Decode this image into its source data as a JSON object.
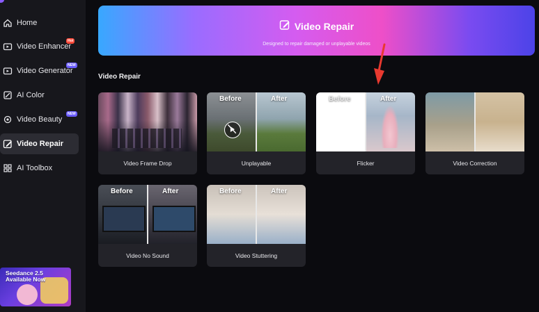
{
  "sidebar": {
    "items": [
      {
        "label": "Home",
        "icon": "home-icon"
      },
      {
        "label": "Video Enhancer",
        "icon": "video-enhancer-icon",
        "badge": "Hot"
      },
      {
        "label": "Video Generator",
        "icon": "video-generator-icon",
        "badge": "NEW"
      },
      {
        "label": "AI Color",
        "icon": "ai-color-icon"
      },
      {
        "label": "Video Beauty",
        "icon": "video-beauty-icon",
        "badge": "NEW"
      },
      {
        "label": "Video Repair",
        "icon": "video-repair-icon",
        "active": true
      },
      {
        "label": "AI Toolbox",
        "icon": "ai-toolbox-icon"
      }
    ],
    "promo": {
      "line1": "Seedance 2.5",
      "line2": "Available Now"
    }
  },
  "banner": {
    "title": "Video Repair",
    "subtitle": "Designed to repair damaged or unplayable videos",
    "icon": "edit-icon"
  },
  "section": {
    "title": "Video Repair"
  },
  "cards": [
    {
      "label": "Video Frame Drop"
    },
    {
      "label": "Unplayable",
      "before": "Before",
      "after": "After"
    },
    {
      "label": "Flicker",
      "before": "Before",
      "after": "After"
    },
    {
      "label": "Video Correction"
    },
    {
      "label": "Video No Sound",
      "before": "Before",
      "after": "After"
    },
    {
      "label": "Video Stuttering",
      "before": "Before",
      "after": "After"
    }
  ],
  "colors": {
    "accent_arrow": "#e8392f",
    "sidebar_bg": "#17171c",
    "page_bg": "#0b0b0f"
  }
}
